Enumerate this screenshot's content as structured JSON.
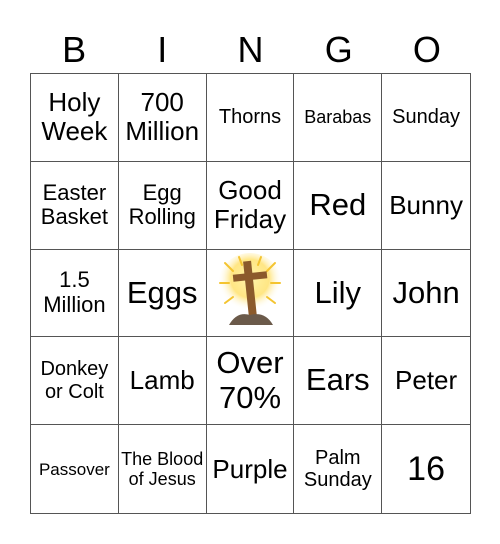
{
  "header": [
    "B",
    "I",
    "N",
    "G",
    "O"
  ],
  "cells": [
    "Holy Week",
    "700 Million",
    "Thorns",
    "Barabas",
    "Sunday",
    "Easter Basket",
    "Egg Rolling",
    "Good Friday",
    "Red",
    "Bunny",
    "1.5 Million",
    "Eggs",
    "",
    "Lily",
    "John",
    "Donkey or Colt",
    "Lamb",
    "Over 70%",
    "Ears",
    "Peter",
    "Passover",
    "The Blood of Jesus",
    "Purple",
    "Palm Sunday",
    "16"
  ],
  "free_space": {
    "icon": "cross-icon"
  }
}
